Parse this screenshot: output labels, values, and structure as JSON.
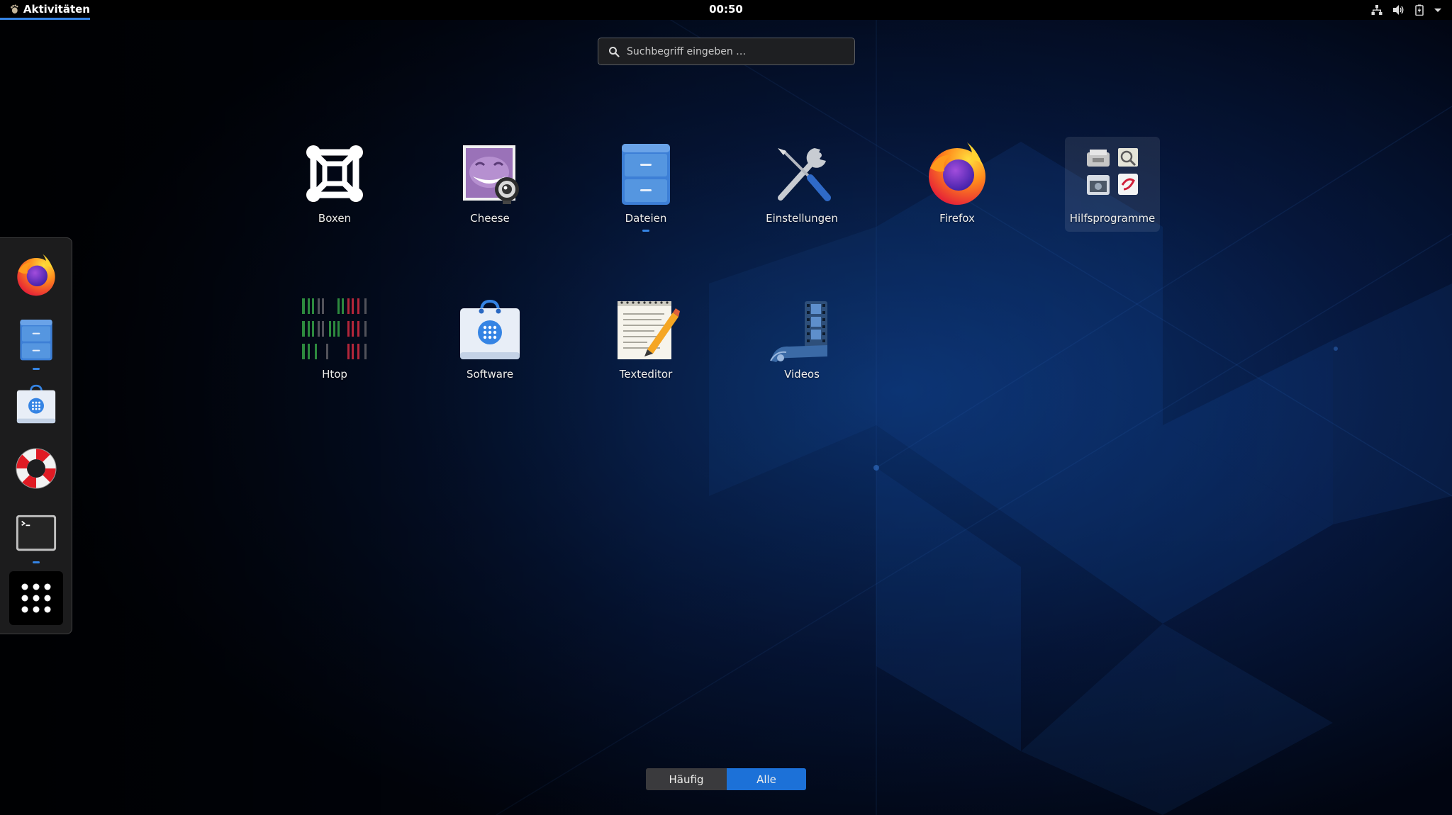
{
  "topbar": {
    "activities_label": "Aktivitäten",
    "clock": "00:50",
    "tray_icons": [
      "network-wired-icon",
      "volume-icon",
      "battery-icon",
      "system-menu-arrow-icon"
    ]
  },
  "search": {
    "placeholder": "Suchbegriff eingeben …",
    "value": ""
  },
  "apps": [
    {
      "label": "Boxen",
      "icon": "boxes-icon"
    },
    {
      "label": "Cheese",
      "icon": "cheese-icon"
    },
    {
      "label": "Dateien",
      "icon": "files-icon",
      "running": true
    },
    {
      "label": "Einstellungen",
      "icon": "settings-icon"
    },
    {
      "label": "Firefox",
      "icon": "firefox-icon"
    },
    {
      "label": "Hilfsprogramme",
      "icon": "utilities-folder-icon",
      "folder": true
    },
    {
      "label": "Htop",
      "icon": "htop-icon"
    },
    {
      "label": "Software",
      "icon": "software-icon"
    },
    {
      "label": "Texteditor",
      "icon": "text-editor-icon"
    },
    {
      "label": "Videos",
      "icon": "videos-icon"
    }
  ],
  "dash": {
    "items": [
      {
        "icon": "firefox-icon",
        "running": false
      },
      {
        "icon": "files-icon",
        "running": true
      },
      {
        "icon": "software-icon",
        "running": false
      },
      {
        "icon": "help-icon",
        "running": false
      },
      {
        "icon": "terminal-icon",
        "running": true
      },
      {
        "icon": "show-apps-icon",
        "running": false
      }
    ]
  },
  "view_toggle": {
    "frequent_label": "Häufig",
    "all_label": "Alle",
    "active": "all"
  },
  "colors": {
    "accent": "#3584e4",
    "selected_toggle": "#1c71d8"
  }
}
